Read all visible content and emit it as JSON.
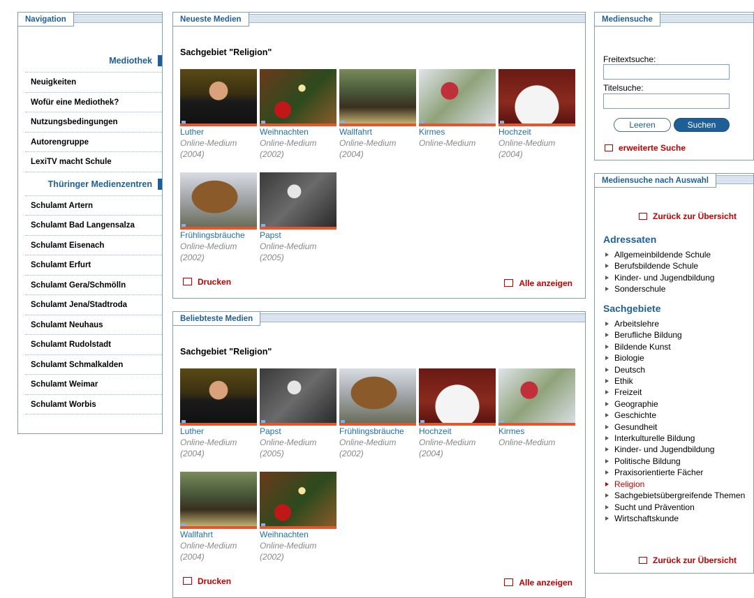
{
  "nav": {
    "title": "Navigation",
    "section1": "Mediothek",
    "items1": [
      "Neuigkeiten",
      "Wofür eine Mediothek?",
      "Nutzungsbedingungen",
      "Autorengruppe",
      "LexiTV macht Schule"
    ],
    "section2": "Thüringer Medienzentren",
    "items2": [
      "Schulamt Artern",
      "Schulamt Bad Langensalza",
      "Schulamt Eisenach",
      "Schulamt Erfurt",
      "Schulamt Gera/Schmölln",
      "Schulamt Jena/Stadtroda",
      "Schulamt Neuhaus",
      "Schulamt Rudolstadt",
      "Schulamt Schmalkalden",
      "Schulamt Weimar",
      "Schulamt Worbis"
    ]
  },
  "neueste": {
    "title": "Neueste Medien",
    "subject": "Sachgebiet \"Religion\"",
    "media": [
      {
        "title": "Luther",
        "type": "Online-Medium",
        "year": "(2004)"
      },
      {
        "title": "Weihnachten",
        "type": "Online-Medium",
        "year": "(2002)"
      },
      {
        "title": "Wallfahrt",
        "type": "Online-Medium",
        "year": "(2004)"
      },
      {
        "title": "Kirmes",
        "type": "Online-Medium",
        "year": ""
      },
      {
        "title": "Hochzeit",
        "type": "Online-Medium",
        "year": "(2004)"
      },
      {
        "title": "Frühlingsbräuche",
        "type": "Online-Medium",
        "year": "(2002)"
      },
      {
        "title": "Papst",
        "type": "Online-Medium",
        "year": "(2005)"
      }
    ],
    "print": "Drucken",
    "all": "Alle anzeigen"
  },
  "beliebteste": {
    "title": "Beliebteste Medien",
    "subject": "Sachgebiet \"Religion\"",
    "media": [
      {
        "title": "Luther",
        "type": "Online-Medium",
        "year": "(2004)"
      },
      {
        "title": "Papst",
        "type": "Online-Medium",
        "year": "(2005)"
      },
      {
        "title": "Frühlingsbräuche",
        "type": "Online-Medium",
        "year": "(2002)"
      },
      {
        "title": "Hochzeit",
        "type": "Online-Medium",
        "year": "(2004)"
      },
      {
        "title": "Kirmes",
        "type": "Online-Medium",
        "year": ""
      },
      {
        "title": "Wallfahrt",
        "type": "Online-Medium",
        "year": "(2004)"
      },
      {
        "title": "Weihnachten",
        "type": "Online-Medium",
        "year": "(2002)"
      }
    ],
    "print": "Drucken",
    "all": "Alle anzeigen"
  },
  "suche": {
    "title": "Mediensuche",
    "freitext_label": "Freitextsuche:",
    "freitext_value": "",
    "titel_label": "Titelsuche:",
    "titel_value": "",
    "leeren": "Leeren",
    "suchen": "Suchen",
    "erweitert": "erweiterte Suche"
  },
  "auswahl": {
    "title": "Mediensuche nach Auswahl",
    "back": "Zurück zur Übersicht",
    "adressaten_head": "Adressaten",
    "adressaten": [
      "Allgemeinbildende Schule",
      "Berufsbildende Schule",
      "Kinder- und Jugendbildung",
      "Sonderschule"
    ],
    "sachgebiete_head": "Sachgebiete",
    "sachgebiete": [
      "Arbeitslehre",
      "Berufliche Bildung",
      "Bildende Kunst",
      "Biologie",
      "Deutsch",
      "Ethik",
      "Freizeit",
      "Geographie",
      "Geschichte",
      "Gesundheit",
      "Interkulturelle Bildung",
      "Kinder- und Jugendbildung",
      "Politische Bildung",
      "Praxisorientierte Fächer",
      "Religion",
      "Sachgebietsübergreifende Themen",
      "Sucht und Prävention",
      "Wirtschaftskunde"
    ],
    "active": "Religion",
    "back_bottom": "Zurück zur Übersicht"
  },
  "colors": {
    "accent": "#1f5f97",
    "link_red": "#c00000",
    "media_bar": "#e4572e"
  }
}
